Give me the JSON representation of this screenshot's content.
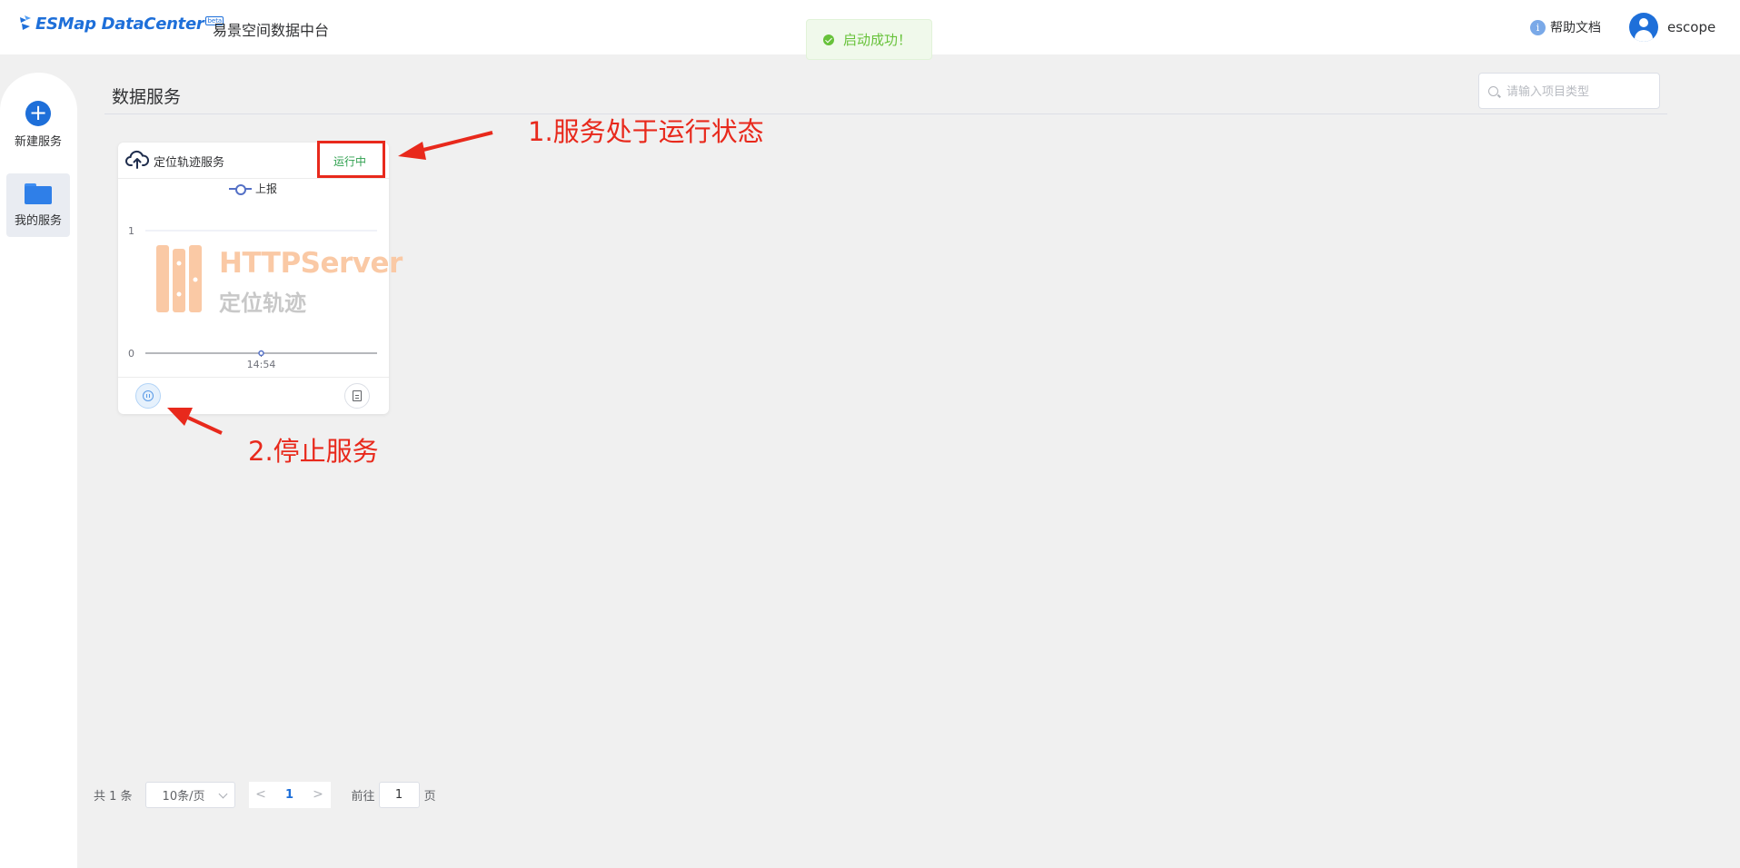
{
  "header": {
    "logo_text": "ESMap DataCenter",
    "logo_badge": "beta",
    "app_name": "易景空间数据中台",
    "help_label": "帮助文档",
    "help_icon_glyph": "i",
    "username": "escope"
  },
  "toast": {
    "message": "启动成功！",
    "type": "success"
  },
  "sidebar": {
    "items": [
      {
        "label": "新建服务",
        "icon": "plus-circle-icon"
      },
      {
        "label": "我的服务",
        "icon": "folder-icon",
        "active": true
      }
    ]
  },
  "main": {
    "title": "数据服务",
    "search_placeholder": "请输入项目类型"
  },
  "card": {
    "title": "定位轨迹服务",
    "status": "运行中",
    "legend": "上报",
    "watermark_title": "HTTPServer",
    "watermark_sub": "定位轨迹",
    "icons": {
      "header": "cloud-upload-icon",
      "stop": "pause-icon",
      "log": "document-icon"
    }
  },
  "chart_data": {
    "type": "line",
    "title": "",
    "xlabel": "",
    "ylabel": "",
    "x": [
      "14:54"
    ],
    "series": [
      {
        "name": "上报",
        "values": [
          0
        ]
      }
    ],
    "yticks": [
      "0",
      "1"
    ],
    "ylim": [
      0,
      1
    ],
    "color": "#5470c6"
  },
  "annotations": {
    "step1": "1.服务处于运行状态",
    "step2": "2.停止服务",
    "color": "#e8291c"
  },
  "pagination": {
    "total": "共 1 条",
    "page_size": "10条/页",
    "prev": "<",
    "current_page": "1",
    "next": ">",
    "goto_label": "前往",
    "goto_value": "1",
    "goto_suffix": "页"
  },
  "colors": {
    "primary": "#1e6fd9",
    "success": "#67c23a",
    "running": "#2fa04f",
    "annotation": "#e8291c"
  }
}
